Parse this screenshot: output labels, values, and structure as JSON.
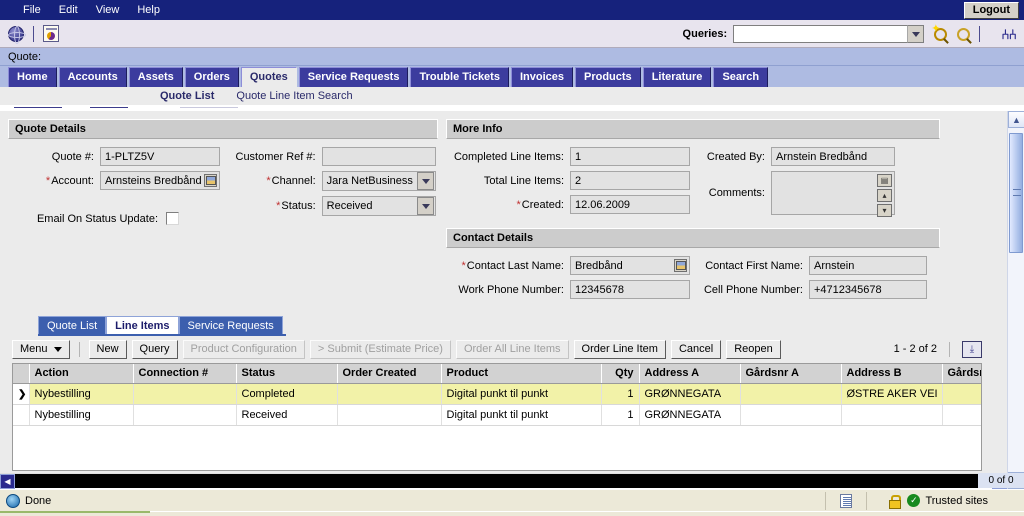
{
  "menu": {
    "items": [
      "File",
      "Edit",
      "View",
      "Help"
    ],
    "logout_label": "Logout"
  },
  "toolbar": {
    "globe_icon": "globe-icon",
    "report_icon": "report-icon",
    "queries_label": "Queries:",
    "queries_value": "",
    "queries_placeholder": "",
    "new_query_icon": "new-query-icon",
    "execute_query_icon": "execute-query-icon",
    "binoculars_icon": "binoculars-icon"
  },
  "screen": {
    "label": "Quote:",
    "value": ""
  },
  "view_tabs": [
    {
      "label": "Home",
      "active": false
    },
    {
      "label": "Accounts",
      "active": false
    },
    {
      "label": "Assets",
      "active": false
    },
    {
      "label": "Orders",
      "active": false
    },
    {
      "label": "Quotes",
      "active": true
    },
    {
      "label": "Service Requests",
      "active": false
    },
    {
      "label": "Trouble Tickets",
      "active": false
    },
    {
      "label": "Invoices",
      "active": false
    },
    {
      "label": "Products",
      "active": false
    },
    {
      "label": "Literature",
      "active": false
    },
    {
      "label": "Search",
      "active": false
    }
  ],
  "sub_views": [
    {
      "label": "Quote List",
      "active": true
    },
    {
      "label": "Quote Line Item Search",
      "active": false
    }
  ],
  "quote_details": {
    "title": "Quote Details",
    "quote_number_label": "Quote #:",
    "quote_number_value": "1-PLTZ5V",
    "account_label": "Account:",
    "account_value": "Arnsteins Bredbånd",
    "customer_ref_label": "Customer Ref #:",
    "customer_ref_value": "",
    "channel_label": "Channel:",
    "channel_value": "Jara NetBusiness",
    "status_label": "Status:",
    "status_value": "Received",
    "email_on_status_label": "Email On Status Update:",
    "email_on_status_checked": false
  },
  "more_info": {
    "title": "More Info",
    "completed_line_items_label": "Completed Line Items:",
    "completed_line_items_value": "1",
    "total_line_items_label": "Total Line Items:",
    "total_line_items_value": "2",
    "created_label": "Created:",
    "created_value": "12.06.2009",
    "created_by_label": "Created By:",
    "created_by_value": "Arnstein Bredbånd",
    "comments_label": "Comments:",
    "comments_value": ""
  },
  "contact_details": {
    "title": "Contact Details",
    "contact_last_name_label": "Contact Last Name:",
    "contact_last_name_value": "Bredbånd",
    "contact_first_name_label": "Contact First Name:",
    "contact_first_name_value": "Arnstein",
    "work_phone_label": "Work Phone Number:",
    "work_phone_value": "12345678",
    "cell_phone_label": "Cell Phone Number:",
    "cell_phone_value": "+4712345678"
  },
  "list_tabs": [
    {
      "label": "Quote List",
      "active": false
    },
    {
      "label": "Line Items",
      "active": true
    },
    {
      "label": "Service Requests",
      "active": false
    }
  ],
  "list_toolbar": {
    "menu_label": "Menu",
    "new_label": "New",
    "query_label": "Query",
    "product_configuration_label": "Product Configuration",
    "submit_label": "> Submit (Estimate Price)",
    "order_all_line_items_label": "Order All Line Items",
    "order_line_item_label": "Order Line Item",
    "cancel_label": "Cancel",
    "reopen_label": "Reopen",
    "record_counter": "1 - 2 of 2",
    "columns_icon": "columns-displayed-icon"
  },
  "table": {
    "columns": [
      "Action",
      "Connection #",
      "Status",
      "Order Created",
      "Product",
      "Qty",
      "Address A",
      "Gårdsnr A",
      "Address B",
      "Gårdsnr"
    ],
    "rows": [
      {
        "selected": true,
        "selector": "❯",
        "cells": [
          "Nybestilling",
          "",
          "Completed",
          "",
          "Digital punkt til punkt",
          "1",
          "GRØNNEGATA",
          "",
          "ØSTRE AKER VEI",
          ""
        ]
      },
      {
        "selected": false,
        "selector": "",
        "cells": [
          "Nybestilling",
          "",
          "Received",
          "",
          "Digital punkt til punkt",
          "1",
          "GRØNNEGATA",
          "",
          "",
          ""
        ]
      }
    ]
  },
  "bottom_scroll": {
    "left_arrow": "◀",
    "right_arrow": "▶",
    "counter": "0 of 0"
  },
  "status_bar": {
    "message": "Done",
    "zone_label": "Trusted sites",
    "page_icon": "page-icon",
    "lock_icon": "lock-icon",
    "security_check_icon": "security-check-icon"
  },
  "colors": {
    "menubar": "#16227c",
    "toolbar": "#e8e4ee",
    "screenbar": "#aebbe2",
    "tab_active_bg": "#ebebeb",
    "tab_bg": "#3c3c9e",
    "selected_row": "#f2f2a8",
    "panel_header": "#cccccc",
    "required_marker": "#c03030"
  }
}
